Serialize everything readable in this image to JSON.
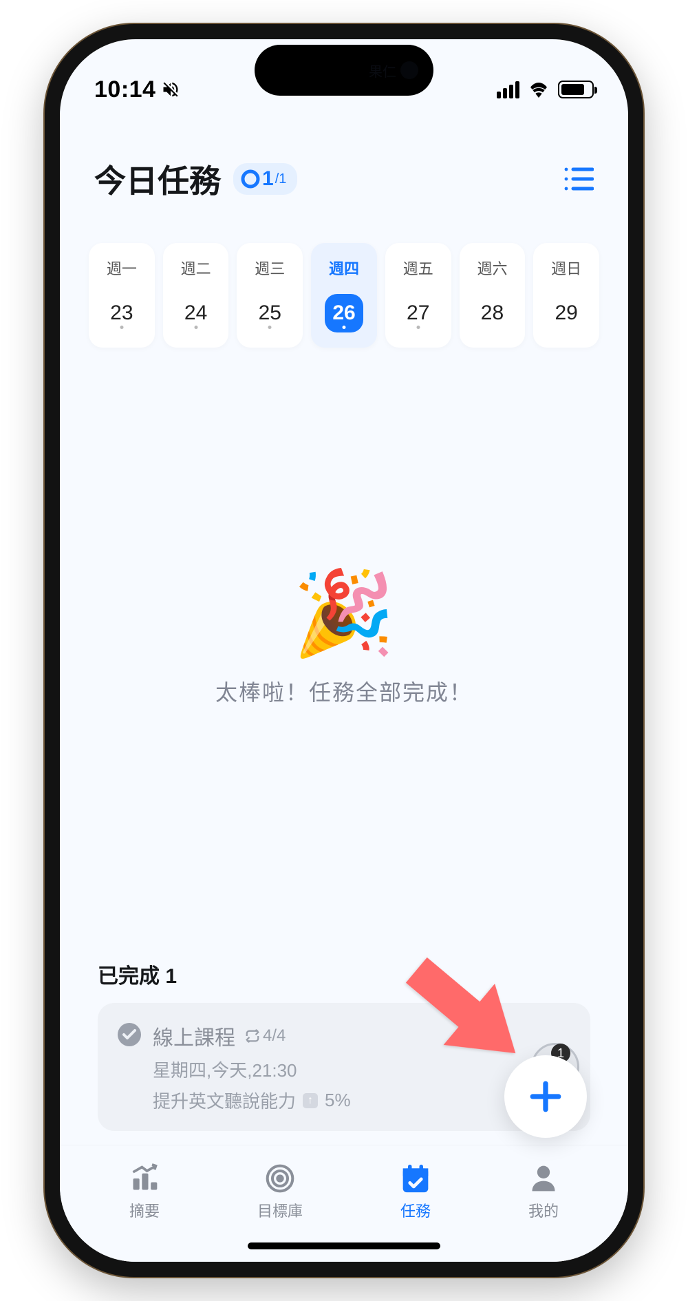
{
  "status_bar": {
    "time": "10:14"
  },
  "header": {
    "title": "今日任務",
    "progress_done": "1",
    "progress_total": "/1"
  },
  "week": {
    "days": [
      {
        "label": "週一",
        "date": "23",
        "selected": false,
        "dot": true
      },
      {
        "label": "週二",
        "date": "24",
        "selected": false,
        "dot": true
      },
      {
        "label": "週三",
        "date": "25",
        "selected": false,
        "dot": true
      },
      {
        "label": "週四",
        "date": "26",
        "selected": true,
        "dot": true
      },
      {
        "label": "週五",
        "date": "27",
        "selected": false,
        "dot": true
      },
      {
        "label": "週六",
        "date": "28",
        "selected": false,
        "dot": false
      },
      {
        "label": "週日",
        "date": "29",
        "selected": false,
        "dot": false
      }
    ]
  },
  "empty_state": {
    "emoji": "🎉",
    "message": "太棒啦！任務全部完成！"
  },
  "completed": {
    "heading": "已完成 1",
    "task": {
      "title": "線上課程",
      "repeat": "4/4",
      "datetime": "星期四,今天,21:30",
      "goal_text": "提升英文聽說能力",
      "goal_delta": "5%",
      "badge": "1"
    }
  },
  "nav": {
    "summary": "摘要",
    "goals": "目標庫",
    "tasks": "任務",
    "mine": "我的"
  }
}
